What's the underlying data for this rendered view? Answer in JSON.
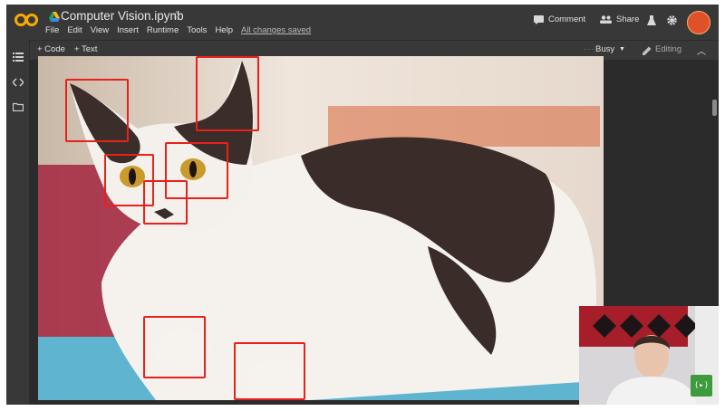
{
  "app": {
    "title": "Computer Vision.ipynb",
    "star": "☆"
  },
  "menu": {
    "items": [
      "File",
      "Edit",
      "View",
      "Insert",
      "Runtime",
      "Tools",
      "Help"
    ],
    "saved_status": "All changes saved"
  },
  "header_actions": {
    "comment": "Comment",
    "share": "Share"
  },
  "toolbar": {
    "add_code": "+ Code",
    "add_text": "+ Text",
    "status": "Busy",
    "editing": "Editing"
  },
  "webcam_badge": "(▸)",
  "colors": {
    "bg": "#383838",
    "accent_box": "#e8211b",
    "status_green": "#3bb56a",
    "logo_orange": "#f9ab00"
  }
}
